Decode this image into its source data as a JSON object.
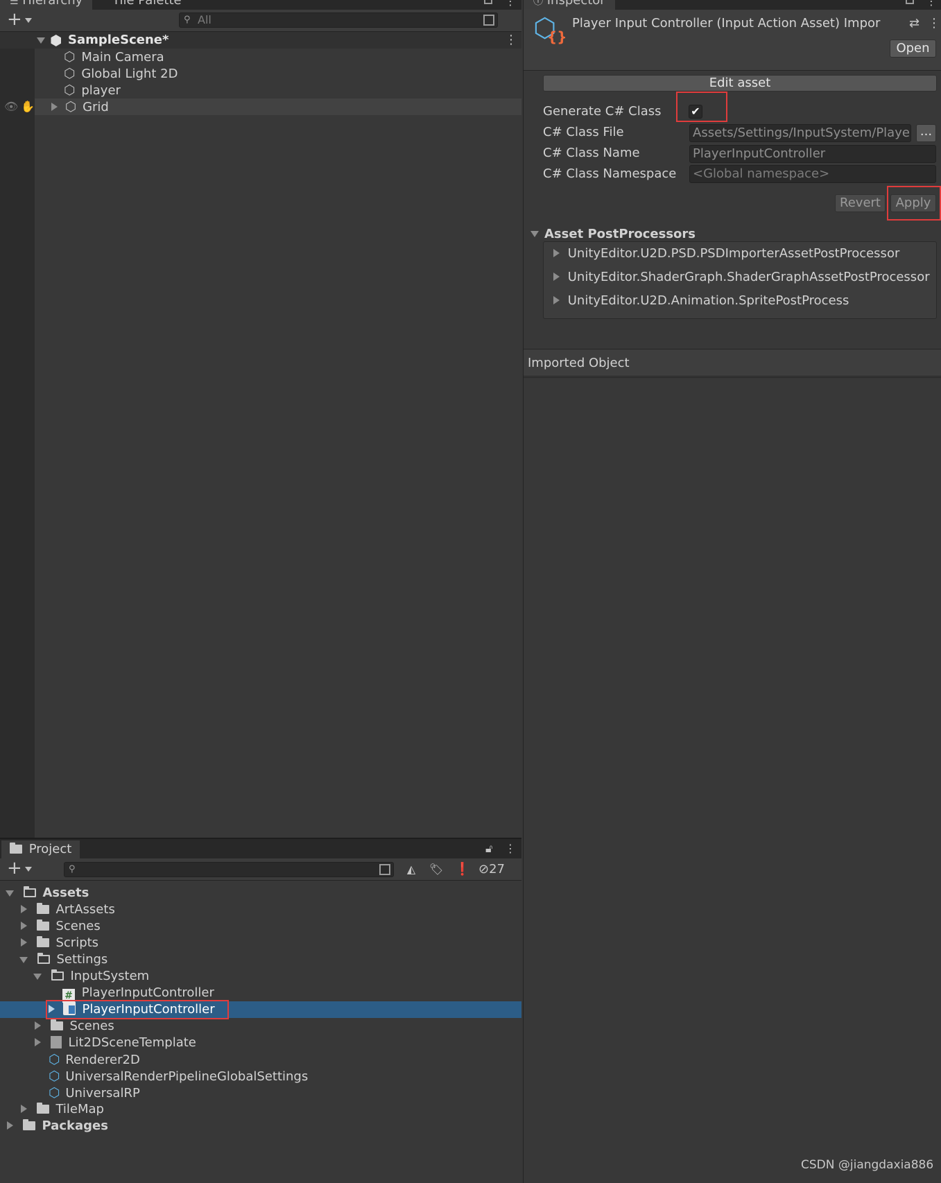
{
  "hierarchy": {
    "tabs": [
      "Hierarchy",
      "Tile Palette"
    ],
    "search_placeholder": "All",
    "scene": "SampleScene*",
    "items": [
      "Main Camera",
      "Global Light 2D",
      "player",
      "Grid"
    ]
  },
  "inspector": {
    "tab": "Inspector",
    "title": "Player Input Controller (Input Action Asset) Impor",
    "open_button": "Open",
    "edit_asset_button": "Edit asset",
    "generate_label": "Generate C# Class",
    "generate_checked": true,
    "class_file_label": "C# Class File",
    "class_file_value": "Assets/Settings/InputSystem/PlayerI",
    "browse_button": "...",
    "class_name_label": "C# Class Name",
    "class_name_value": "PlayerInputController",
    "class_namespace_label": "C# Class Namespace",
    "class_namespace_placeholder": "<Global namespace>",
    "revert_button": "Revert",
    "apply_button": "Apply",
    "postprocessors_title": "Asset PostProcessors",
    "postprocessors": [
      "UnityEditor.U2D.PSD.PSDImporterAssetPostProcessor",
      "UnityEditor.ShaderGraph.ShaderGraphAssetPostProcessor",
      "UnityEditor.U2D.Animation.SpritePostProcess"
    ],
    "imported_object": "Imported Object"
  },
  "project": {
    "tab": "Project",
    "hidden_count": "27",
    "tree": {
      "assets": "Assets",
      "artassets": "ArtAssets",
      "scenes": "Scenes",
      "scripts": "Scripts",
      "settings": "Settings",
      "inputsystem": "InputSystem",
      "pic_script": "PlayerInputController",
      "pic_asset": "PlayerInputController",
      "settings_scenes": "Scenes",
      "lit2d": "Lit2DSceneTemplate",
      "renderer2d": "Renderer2D",
      "urpglobal": "UniversalRenderPipelineGlobalSettings",
      "urp": "UniversalRP",
      "tilemap": "TileMap",
      "packages": "Packages"
    }
  },
  "watermark": "CSDN @jiangdaxia886",
  "colors": {
    "highlight": "#e03c3c",
    "selection": "#2c5d87",
    "asset_icon_accent": "#f06a3c",
    "asset_icon_blue": "#5fb4e6"
  }
}
